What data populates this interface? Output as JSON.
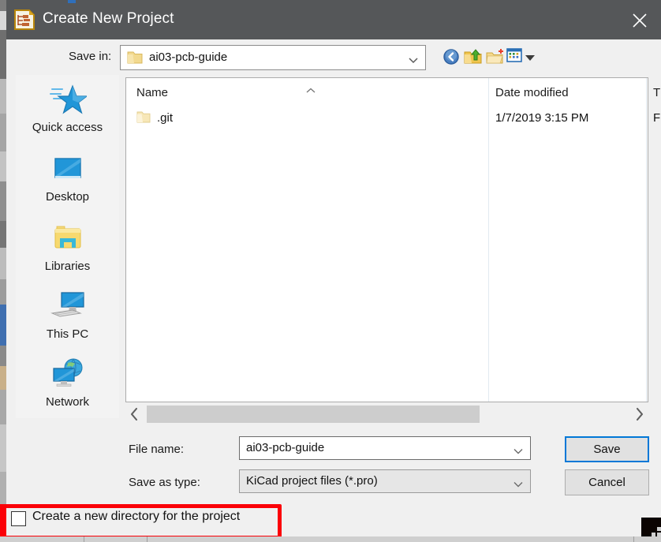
{
  "window": {
    "title": "Create New Project",
    "app_icon": "kicad-project-icon",
    "close_label": "✕",
    "titlebar_color": "#555759",
    "accent_color": "#0078d7",
    "background": "#f0f0f0"
  },
  "toolbar": {
    "save_in_label": "Save in:",
    "save_in_value": "ai03-pcb-guide",
    "buttons": [
      {
        "name": "back-button",
        "icon": "back-arrow-icon"
      },
      {
        "name": "up-one-level-button",
        "icon": "up-folder-icon"
      },
      {
        "name": "new-folder-button",
        "icon": "new-folder-icon"
      },
      {
        "name": "view-menu-button",
        "icon": "view-tiles-icon"
      }
    ]
  },
  "places": {
    "items": [
      {
        "label": "Quick access",
        "icon": "star-icon"
      },
      {
        "label": "Desktop",
        "icon": "monitor-icon"
      },
      {
        "label": "Libraries",
        "icon": "libraries-folder-icon"
      },
      {
        "label": "This PC",
        "icon": "computer-icon"
      },
      {
        "label": "Network",
        "icon": "network-globe-icon"
      }
    ]
  },
  "file_list": {
    "columns": [
      "Name",
      "Date modified",
      "T"
    ],
    "sort_column": "Name",
    "sort_direction": "ascending",
    "rows": [
      {
        "name": ".git",
        "date_modified": "1/7/2019 3:15 PM",
        "type": "F",
        "icon": "folder-icon"
      }
    ]
  },
  "scrollbar": {
    "left_arrow": "‹",
    "right_arrow": "›"
  },
  "form": {
    "file_name_label": "File name:",
    "file_name_value": "ai03-pcb-guide",
    "save_as_type_label": "Save as type:",
    "save_as_type_value": "KiCad project files (*.pro)",
    "save_button": "Save",
    "cancel_button": "Cancel"
  },
  "options": {
    "create_directory_label": "Create a new directory for the project",
    "create_directory_checked": false
  },
  "annotation": {
    "color": "#fb0007",
    "target": "create-directory-checkbox"
  }
}
